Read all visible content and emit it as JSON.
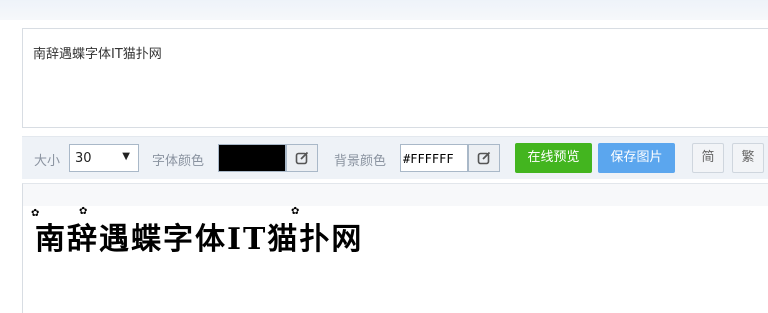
{
  "text_input": {
    "value": "南辞遇蝶字体IT猫扑网"
  },
  "toolbar": {
    "size_label": "大小",
    "size_value": "30",
    "font_color_label": "字体颜色",
    "font_color_value": "#000000",
    "bg_color_label": "背景颜色",
    "bg_color_value": "#FFFFFF",
    "preview_button": "在线预览",
    "save_button": "保存图片",
    "simplified_button": "简",
    "traditional_button": "繁"
  },
  "preview": {
    "rendered_text": "南辞遇蝶字体IT猫扑网"
  },
  "colors": {
    "green_button": "#43b51f",
    "blue_button": "#5ba6ee",
    "toolbar_bg": "#eef2f7"
  },
  "icons": {
    "color_picker": "edit-square-icon",
    "dropdown": "caret-down-icon"
  }
}
